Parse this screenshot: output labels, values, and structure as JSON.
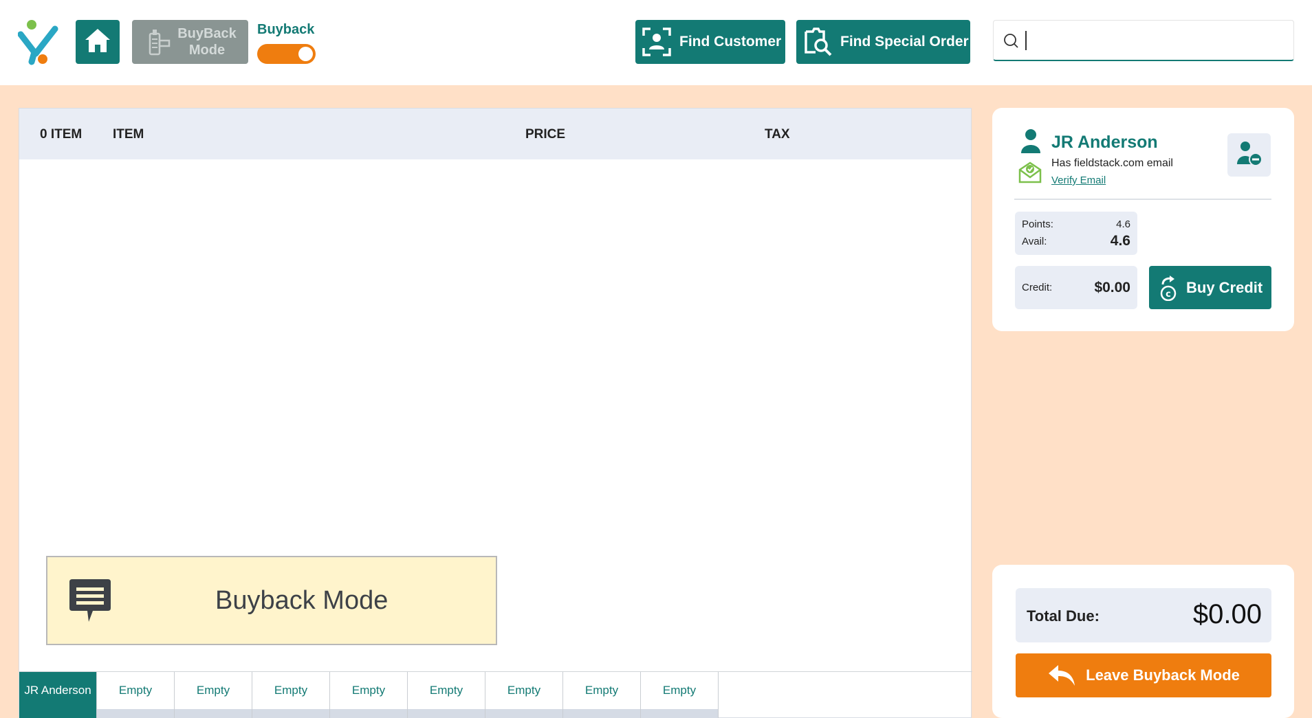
{
  "header": {
    "buyback_mode_button": "BuyBack\nMode",
    "toggle_label": "Buyback",
    "toggle_on": true,
    "find_customer": "Find Customer",
    "find_special_order": "Find Special Order",
    "search": {
      "value": "",
      "placeholder": ""
    }
  },
  "table": {
    "columns": [
      "0 ITEM",
      "ITEM",
      "PRICE",
      "TAX"
    ]
  },
  "notice": {
    "text": "Buyback Mode"
  },
  "tabs": [
    "JR Anderson",
    "Empty",
    "Empty",
    "Empty",
    "Empty",
    "Empty",
    "Empty",
    "Empty",
    "Empty"
  ],
  "customer": {
    "name": "JR Anderson",
    "email_status": "Has fieldstack.com email",
    "verify_link": "Verify Email",
    "points_label": "Points:",
    "points_value": "4.6",
    "avail_label": "Avail:",
    "avail_value": "4.6",
    "credit_label": "Credit:",
    "credit_value": "$0.00",
    "buy_credit": "Buy Credit"
  },
  "totals": {
    "total_label": "Total Due:",
    "total_value": "$0.00",
    "leave_button": "Leave Buyback Mode"
  },
  "colors": {
    "teal": "#137a74",
    "orange": "#ef7d0f",
    "background": "#ffe0c7",
    "notice_bg": "#fff4cc"
  }
}
